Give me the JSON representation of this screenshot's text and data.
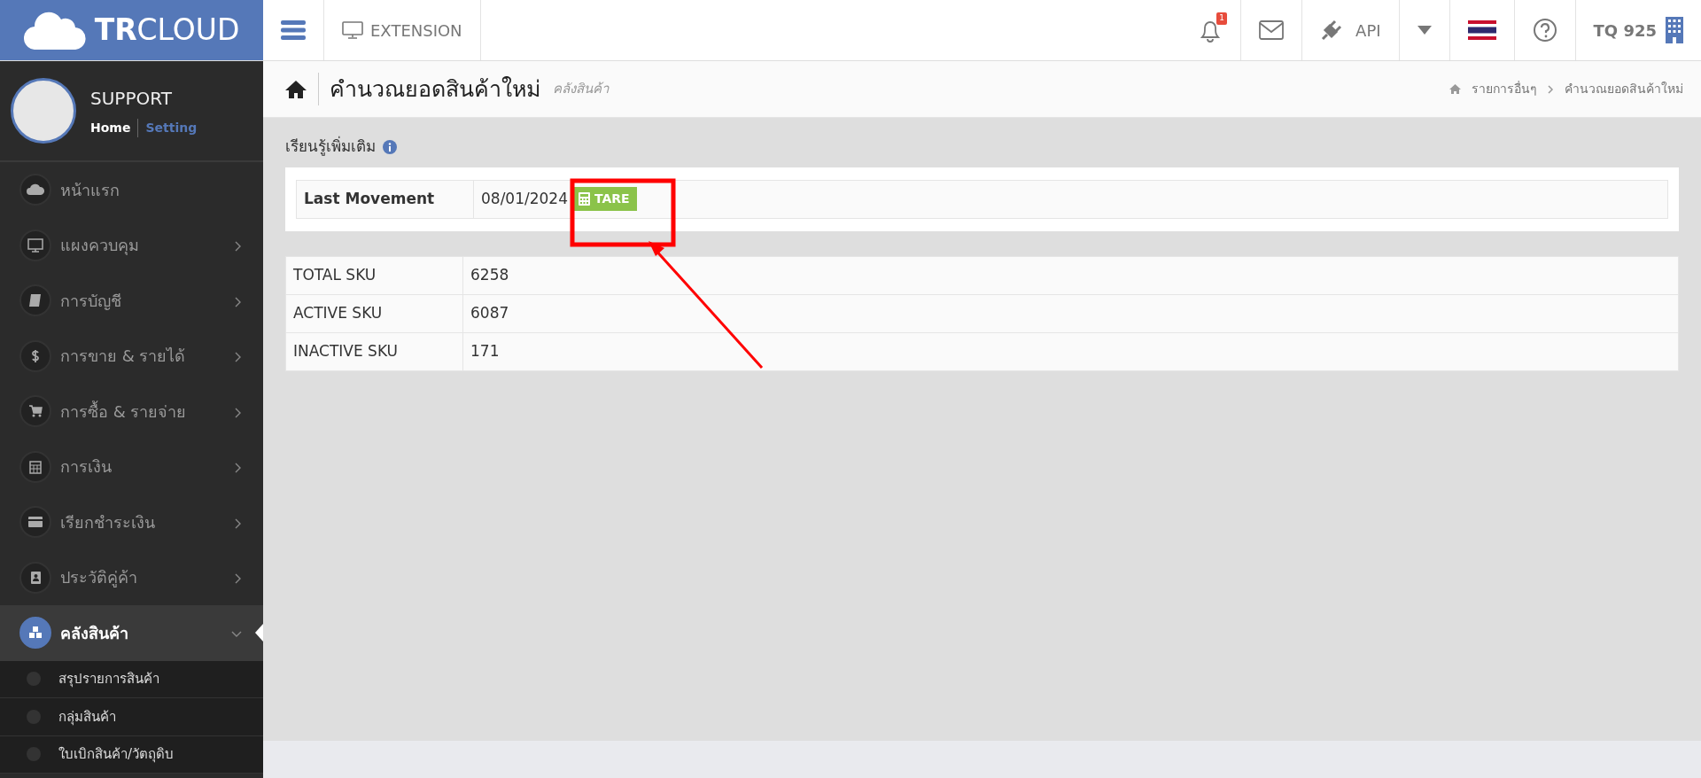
{
  "topbar": {
    "logo": "**TR**CLOUD",
    "extension": "EXTENSION",
    "notification_count": "1",
    "api": "API",
    "account": "TQ 925"
  },
  "sidebar": {
    "profile": {
      "name": "SUPPORT",
      "links": [
        {
          "label": "Home",
          "selected": true
        },
        {
          "label": "Setting",
          "selected": false
        }
      ]
    },
    "items": [
      {
        "label": "หน้าแรก",
        "has_children": false,
        "selected": false
      },
      {
        "label": "แผงควบคุม",
        "has_children": true,
        "expanded": false,
        "selected": false
      },
      {
        "label": "การบัญชี",
        "has_children": true,
        "expanded": false,
        "selected": false
      },
      {
        "label": "การขาย & รายได้",
        "has_children": true,
        "expanded": false,
        "selected": false
      },
      {
        "label": "การซื้อ & รายจ่าย",
        "has_children": true,
        "expanded": false,
        "selected": false
      },
      {
        "label": "การเงิน",
        "has_children": true,
        "expanded": false,
        "selected": false
      },
      {
        "label": "เรียกชำระเงิน",
        "has_children": true,
        "expanded": false,
        "selected": false
      },
      {
        "label": "ประวัติคู่ค้า",
        "has_children": true,
        "expanded": false,
        "selected": false
      },
      {
        "label": "คลังสินค้า",
        "has_children": true,
        "expanded": true,
        "selected": true,
        "children": [
          {
            "label": "สรุปรายการสินค้า"
          },
          {
            "label": "กลุ่มสินค้า"
          },
          {
            "label": "ใบเบิกสินค้า/วัตถุดิบ"
          }
        ]
      }
    ]
  },
  "page_header": {
    "title": "คำนวณยอดสินค้าใหม่",
    "subtitle": "คลังสินค้า",
    "breadcrumb": [
      "รายการอื่นๆ",
      "คำนวณยอดสินค้าใหม่"
    ]
  },
  "learn_more": "เรียนรู้เพิ่มเติม",
  "movement": {
    "label": "Last Movement",
    "date": "08/01/2024",
    "button": "TARE"
  },
  "sku_table": {
    "rows": [
      {
        "label": "TOTAL SKU",
        "value": "6258"
      },
      {
        "label": "ACTIVE SKU",
        "value": "6087"
      },
      {
        "label": "INACTIVE SKU",
        "value": "171"
      }
    ]
  }
}
